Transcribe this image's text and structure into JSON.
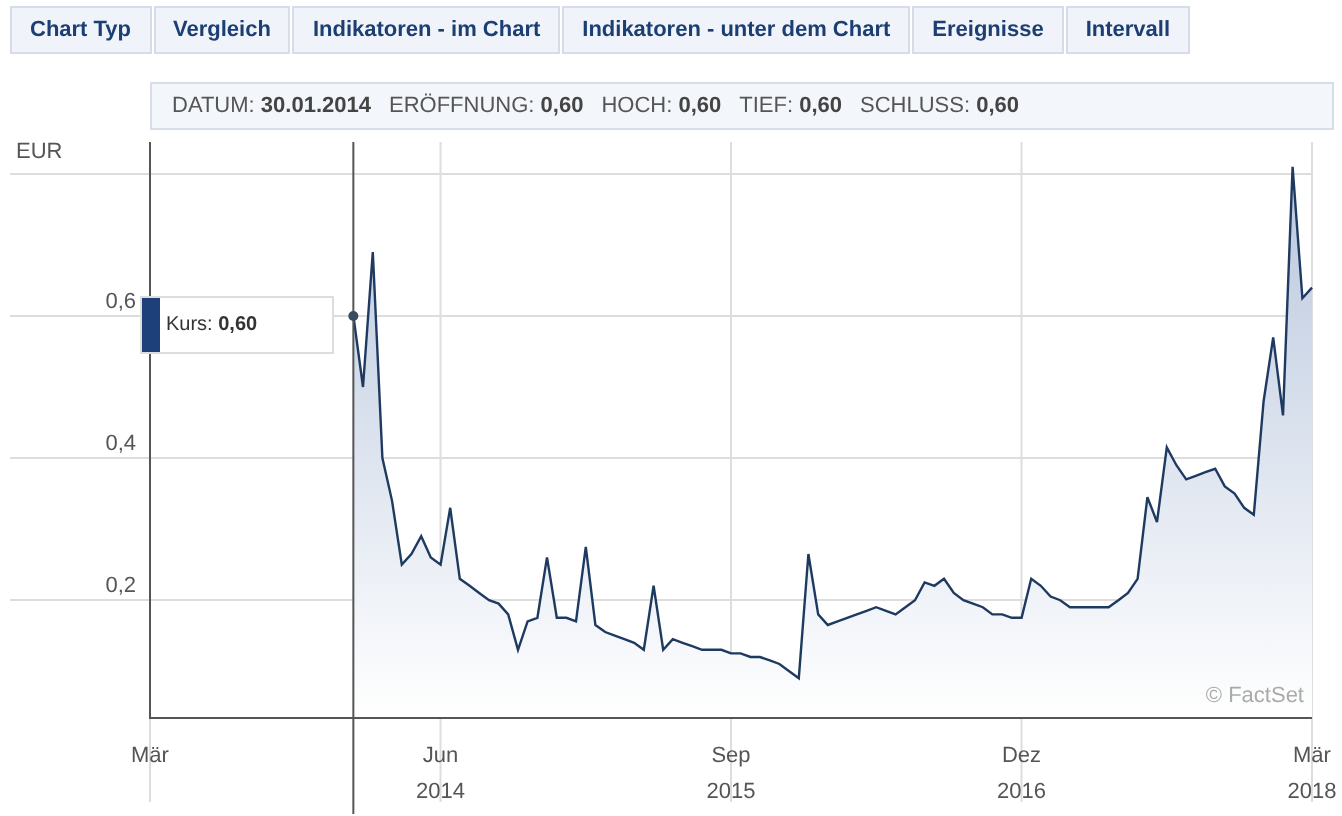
{
  "tabs": [
    {
      "label": "Chart Typ"
    },
    {
      "label": "Vergleich"
    },
    {
      "label": "Indikatoren - im Chart"
    },
    {
      "label": "Indikatoren - unter dem Chart"
    },
    {
      "label": "Ereignisse"
    },
    {
      "label": "Intervall"
    }
  ],
  "info_bar": [
    {
      "label": "DATUM:",
      "value": "30.01.2014"
    },
    {
      "label": "ERÖFFNUNG:",
      "value": "0,60"
    },
    {
      "label": "HOCH:",
      "value": "0,60"
    },
    {
      "label": "TIEF:",
      "value": "0,60"
    },
    {
      "label": "SCHLUSS:",
      "value": "0,60"
    }
  ],
  "tooltip": {
    "label": "Kurs:",
    "value": "0,60",
    "color": "#1d3f7a"
  },
  "credit": "© FactSet",
  "chart_data": {
    "type": "area",
    "ylabel": "EUR",
    "categories": [
      "Mär",
      null,
      null,
      null,
      null,
      null,
      null,
      null,
      null,
      null,
      null,
      null,
      null,
      null,
      null,
      null,
      null,
      null,
      null,
      null,
      null,
      null,
      null,
      null,
      null,
      null,
      null,
      null,
      null,
      null,
      "Jun 2014",
      null,
      null,
      null,
      null,
      null,
      null,
      null,
      null,
      null,
      null,
      null,
      null,
      null,
      null,
      null,
      null,
      null,
      null,
      null,
      null,
      null,
      null,
      null,
      null,
      null,
      null,
      null,
      null,
      null,
      "Sep 2015",
      null,
      null,
      null,
      null,
      null,
      null,
      null,
      null,
      null,
      null,
      null,
      null,
      null,
      null,
      null,
      null,
      null,
      null,
      null,
      null,
      null,
      null,
      null,
      null,
      null,
      null,
      null,
      null,
      null,
      "Dez 2016",
      null,
      null,
      null,
      null,
      null,
      null,
      null,
      null,
      null,
      null,
      null,
      null,
      null,
      null,
      null,
      null,
      null,
      null,
      null,
      null,
      null,
      null,
      null,
      null,
      null,
      null,
      null,
      null,
      null,
      "Mär 2018"
    ],
    "series": [
      {
        "color": "#1f3a60",
        "values": [
          null,
          null,
          null,
          null,
          null,
          null,
          null,
          null,
          null,
          null,
          null,
          null,
          null,
          null,
          null,
          null,
          null,
          null,
          null,
          null,
          null,
          0.6,
          0.5,
          0.69,
          0.4,
          0.34,
          0.25,
          0.265,
          0.29,
          0.26,
          0.25,
          0.33,
          0.23,
          0.22,
          0.21,
          0.2,
          0.195,
          0.18,
          0.13,
          0.17,
          0.175,
          0.26,
          0.175,
          0.175,
          0.17,
          0.275,
          0.165,
          0.155,
          0.15,
          0.145,
          0.14,
          0.13,
          0.22,
          0.13,
          0.145,
          0.14,
          0.135,
          0.13,
          0.13,
          0.13,
          0.125,
          0.125,
          0.12,
          0.12,
          0.115,
          0.11,
          0.1,
          0.09,
          0.265,
          0.18,
          0.165,
          0.17,
          0.175,
          0.18,
          0.185,
          0.19,
          0.185,
          0.18,
          0.19,
          0.2,
          0.225,
          0.22,
          0.23,
          0.21,
          0.2,
          0.195,
          0.19,
          0.18,
          0.18,
          0.175,
          0.175,
          0.23,
          0.22,
          0.205,
          0.2,
          0.19,
          0.19,
          0.19,
          0.19,
          0.19,
          0.2,
          0.21,
          0.23,
          0.345,
          0.31,
          0.415,
          0.39,
          0.37,
          0.375,
          0.38,
          0.385,
          0.36,
          0.35,
          0.33,
          0.32,
          0.48,
          0.57,
          0.46,
          0.81,
          0.625,
          0.64
        ]
      }
    ],
    "ylim": [
      0.034,
      0.845
    ],
    "grid": true,
    "yticks": [
      {
        "value": 0.2,
        "label": "0,2"
      },
      {
        "value": 0.4,
        "label": "0,4"
      },
      {
        "value": 0.6,
        "label": "0,6"
      }
    ]
  }
}
